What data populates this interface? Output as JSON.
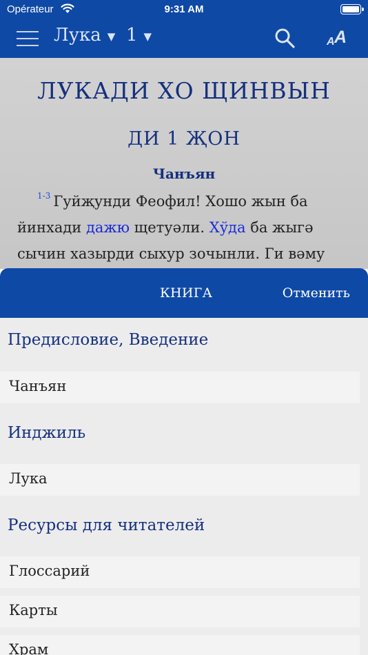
{
  "status_bar": {
    "carrier": "Opérateur",
    "time": "9:31 AM",
    "wifi_icon": "wifi-icon",
    "battery_icon": "battery-icon"
  },
  "nav": {
    "book": "Лука",
    "chapter": "1",
    "menu_icon": "hamburger-menu-icon",
    "search_icon": "search-icon",
    "font_icon": "text-size-icon"
  },
  "reader": {
    "book_title": "ЛУКАДИ ХО ЩИНВЫН",
    "chapter_heading": "ДИ 1 ҖОН",
    "section_heading": "Чанъян",
    "verse": {
      "number": "1-3",
      "part1": "Гуйҗунди Феофил! Хошо жын ба йинхади ",
      "link1": "дажю",
      "part2": " щетуәли. ",
      "link2": "Хўда",
      "part3": " ба жыгә сычин хазырди сыхур зочынли. Ги вәму"
    }
  },
  "sheet": {
    "title": "КНИГА",
    "cancel": "Отменить",
    "groups": [
      {
        "header": "Предисловие, Введение",
        "items": [
          "Чанъян"
        ]
      },
      {
        "header": "Инджиль",
        "items": [
          "Лука"
        ]
      },
      {
        "header": "Ресурсы для читателей",
        "items": [
          "Глоссарий",
          "Карты",
          "Храм"
        ]
      }
    ]
  },
  "colors": {
    "brand_blue": "#0f49a6",
    "heading_navy": "#15307e",
    "link_blue": "#1a2bd8"
  }
}
